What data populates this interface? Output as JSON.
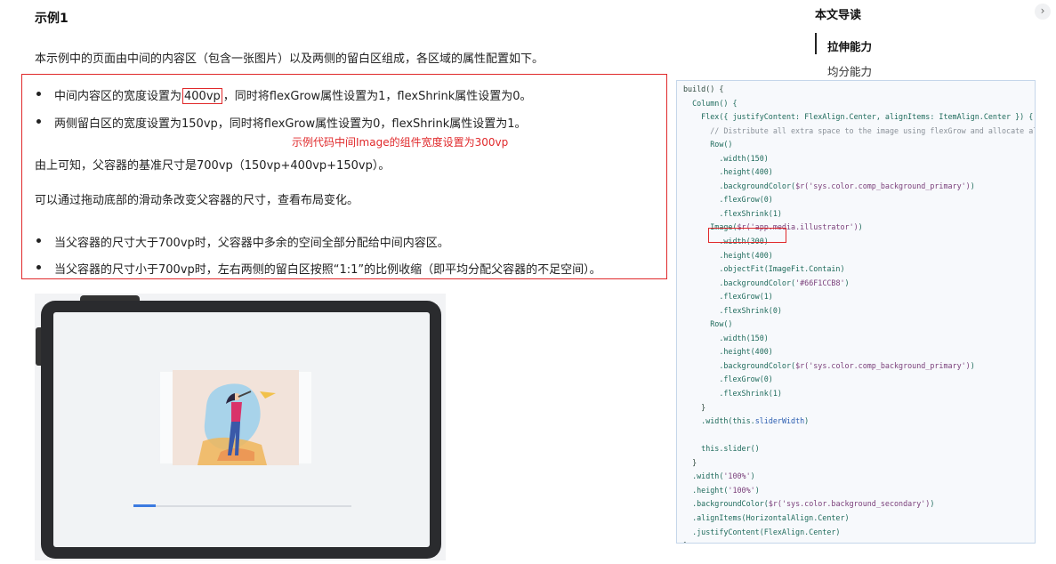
{
  "article": {
    "title": "示例1",
    "intro": "本示例中的页面由中间的内容区（包含一张图片）以及两侧的留白区组成，各区域的属性配置如下。",
    "bullet1": {
      "prefix": "中间内容区的宽度设置为",
      "highlight": "400vp",
      "suffix": "，同时将flexGrow属性设置为1，flexShrink属性设置为0。"
    },
    "bullet2": "两侧留白区的宽度设置为150vp，同时将flexGrow属性设置为0，flexShrink属性设置为1。",
    "annotation": "示例代码中间Image的组件宽度设置为300vp",
    "para1": "由上可知，父容器的基准尺寸是700vp（150vp+400vp+150vp）。",
    "para2": "可以通过拖动底部的滑动条改变父容器的尺寸，查看布局变化。",
    "bullet3": "当父容器的尺寸大于700vp时，父容器中多余的空间全部分配给中间内容区。",
    "bullet4": "当父容器的尺寸小于700vp时，左右两侧的留白区按照“1:1”的比例收缩（即平均分配父容器的不足空间）。"
  },
  "toc": {
    "title": "本文导读",
    "collapse_icon": "›",
    "items": [
      "拉伸能力",
      "均分能力"
    ]
  },
  "mock": {
    "slider_value": 0.1
  },
  "code": {
    "lines": [
      [
        [
          "build() {",
          "plain"
        ]
      ],
      [
        [
          "  Column() {",
          "call"
        ]
      ],
      [
        [
          "    Flex({ justifyContent: FlexAlign.Center, alignItems: ItemAlign.Center }) {",
          "call"
        ]
      ],
      [
        [
          "      // Distribute all extra space to the image using flexGrow and allocate all",
          "com"
        ]
      ],
      [
        [
          "      Row()",
          "call"
        ]
      ],
      [
        [
          "        .width(150)",
          "call"
        ]
      ],
      [
        [
          "        .height(400)",
          "call"
        ]
      ],
      [
        [
          "        .backgroundColor(",
          "call"
        ],
        [
          "$r('sys.color.comp_background_primary')",
          "str"
        ],
        [
          ")",
          "call"
        ]
      ],
      [
        [
          "        .flexGrow(0)",
          "call"
        ]
      ],
      [
        [
          "        .flexShrink(1)",
          "call"
        ]
      ],
      [
        [
          "      Image(",
          "call"
        ],
        [
          "$r('app.media.illustrator')",
          "str"
        ],
        [
          ")",
          "call"
        ]
      ],
      [
        [
          "        .width(300)",
          "call"
        ]
      ],
      [
        [
          "        .height(400)",
          "call"
        ]
      ],
      [
        [
          "        .objectFit(ImageFit.Contain)",
          "call"
        ]
      ],
      [
        [
          "        .backgroundColor(",
          "call"
        ],
        [
          "'#66F1CCB8'",
          "str"
        ],
        [
          ")",
          "call"
        ]
      ],
      [
        [
          "        .flexGrow(1)",
          "call"
        ]
      ],
      [
        [
          "        .flexShrink(0)",
          "call"
        ]
      ],
      [
        [
          "      Row()",
          "call"
        ]
      ],
      [
        [
          "        .width(150)",
          "call"
        ]
      ],
      [
        [
          "        .height(400)",
          "call"
        ]
      ],
      [
        [
          "        .backgroundColor(",
          "call"
        ],
        [
          "$r('sys.color.comp_background_primary')",
          "str"
        ],
        [
          ")",
          "call"
        ]
      ],
      [
        [
          "        .flexGrow(0)",
          "call"
        ]
      ],
      [
        [
          "        .flexShrink(1)",
          "call"
        ]
      ],
      [
        [
          "    }",
          "plain"
        ]
      ],
      [
        [
          "    .width(this.",
          "call"
        ],
        [
          "sliderWidth",
          "prop"
        ],
        [
          ")",
          "call"
        ]
      ],
      [
        [
          "",
          "plain"
        ]
      ],
      [
        [
          "    this.slider()",
          "call"
        ]
      ],
      [
        [
          "  }",
          "plain"
        ]
      ],
      [
        [
          "  .width(",
          "call"
        ],
        [
          "'100%'",
          "str"
        ],
        [
          ")",
          "call"
        ]
      ],
      [
        [
          "  .height(",
          "call"
        ],
        [
          "'100%'",
          "str"
        ],
        [
          ")",
          "call"
        ]
      ],
      [
        [
          "  .backgroundColor(",
          "call"
        ],
        [
          "$r('sys.color.background_secondary')",
          "str"
        ],
        [
          ")",
          "call"
        ]
      ],
      [
        [
          "  .alignItems(HorizontalAlign.Center)",
          "call"
        ]
      ],
      [
        [
          "  .justifyContent(FlexAlign.Center)",
          "call"
        ]
      ],
      [
        [
          "}",
          "plain"
        ]
      ]
    ]
  }
}
